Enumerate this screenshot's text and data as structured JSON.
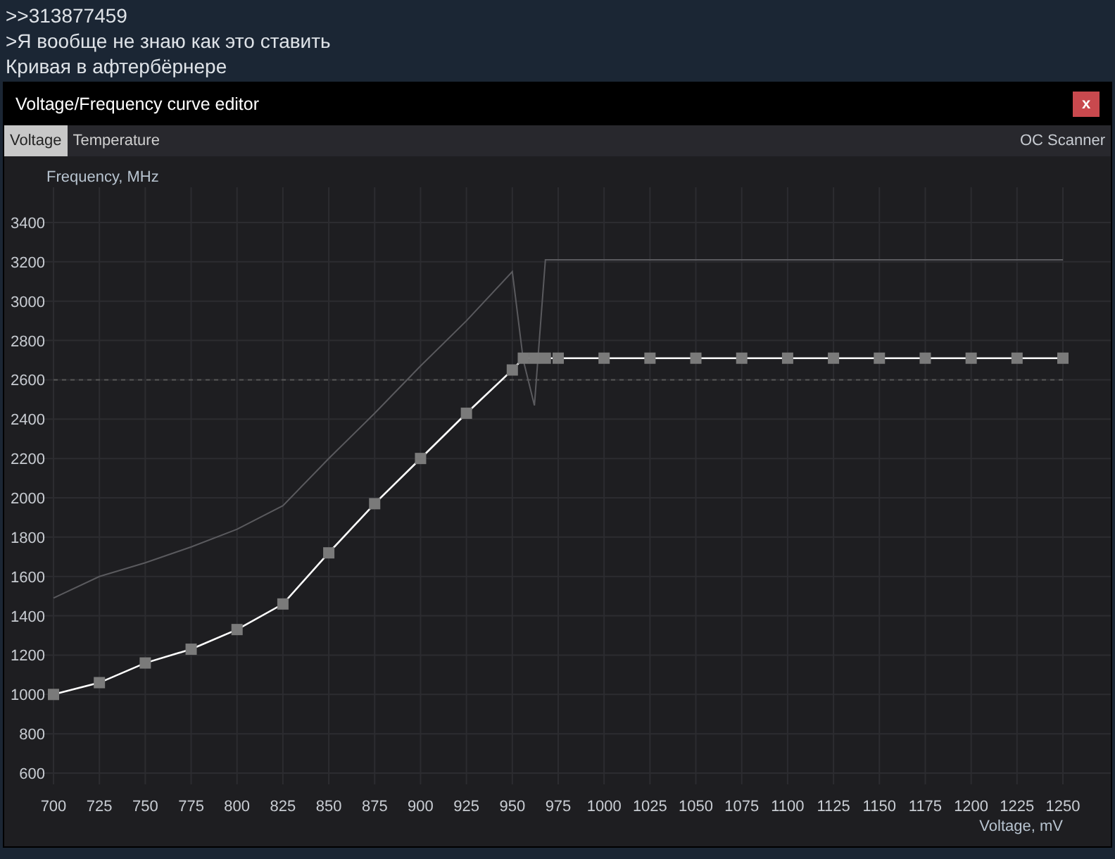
{
  "post": {
    "lines": [
      ">>313877459",
      ">Я вообще не знаю как это ставить",
      "Кривая в афтербёрнере"
    ]
  },
  "window": {
    "title": "Voltage/Frequency curve editor",
    "close": "x"
  },
  "tabs": [
    {
      "label": "Voltage",
      "selected": true
    },
    {
      "label": "Temperature",
      "selected": false
    }
  ],
  "scanner": "OC Scanner",
  "chart_data": {
    "type": "line",
    "xlabel": "Voltage, mV",
    "ylabel": "Frequency, MHz",
    "x": [
      700,
      725,
      750,
      775,
      800,
      825,
      850,
      875,
      900,
      925,
      950,
      956,
      962,
      968,
      975,
      1000,
      1025,
      1050,
      1075,
      1100,
      1125,
      1150,
      1175,
      1200,
      1225,
      1250
    ],
    "series": [
      {
        "color": "#ffffff",
        "marker": "square",
        "values": [
          1000,
          1060,
          1160,
          1230,
          1330,
          1460,
          1720,
          1970,
          2200,
          2430,
          2650,
          2710,
          2710,
          2710,
          2710,
          2710,
          2710,
          2710,
          2710,
          2710,
          2710,
          2710,
          2710,
          2710,
          2710,
          2710
        ]
      },
      {
        "color": "#5a5a5e",
        "values": [
          1490,
          1600,
          1670,
          1750,
          1840,
          1960,
          2200,
          2430,
          2670,
          2900,
          3150,
          2700,
          2470,
          3210,
          3210,
          3210,
          3210,
          3210,
          3210,
          3210,
          3210,
          3210,
          3210,
          3210,
          3210,
          3210
        ]
      }
    ],
    "xlim": [
      700,
      1250
    ],
    "ylim": [
      600,
      3400
    ],
    "xticks": [
      700,
      725,
      750,
      775,
      800,
      825,
      850,
      875,
      900,
      925,
      950,
      975,
      1000,
      1025,
      1050,
      1075,
      1100,
      1125,
      1150,
      1175,
      1200,
      1225,
      1250
    ],
    "yticks": [
      600,
      800,
      1000,
      1200,
      1400,
      1600,
      1800,
      2000,
      2200,
      2400,
      2600,
      2800,
      3000,
      3200,
      3400
    ],
    "grid": true,
    "ref_lines": [
      {
        "axis": "y",
        "value": 2600
      }
    ]
  }
}
